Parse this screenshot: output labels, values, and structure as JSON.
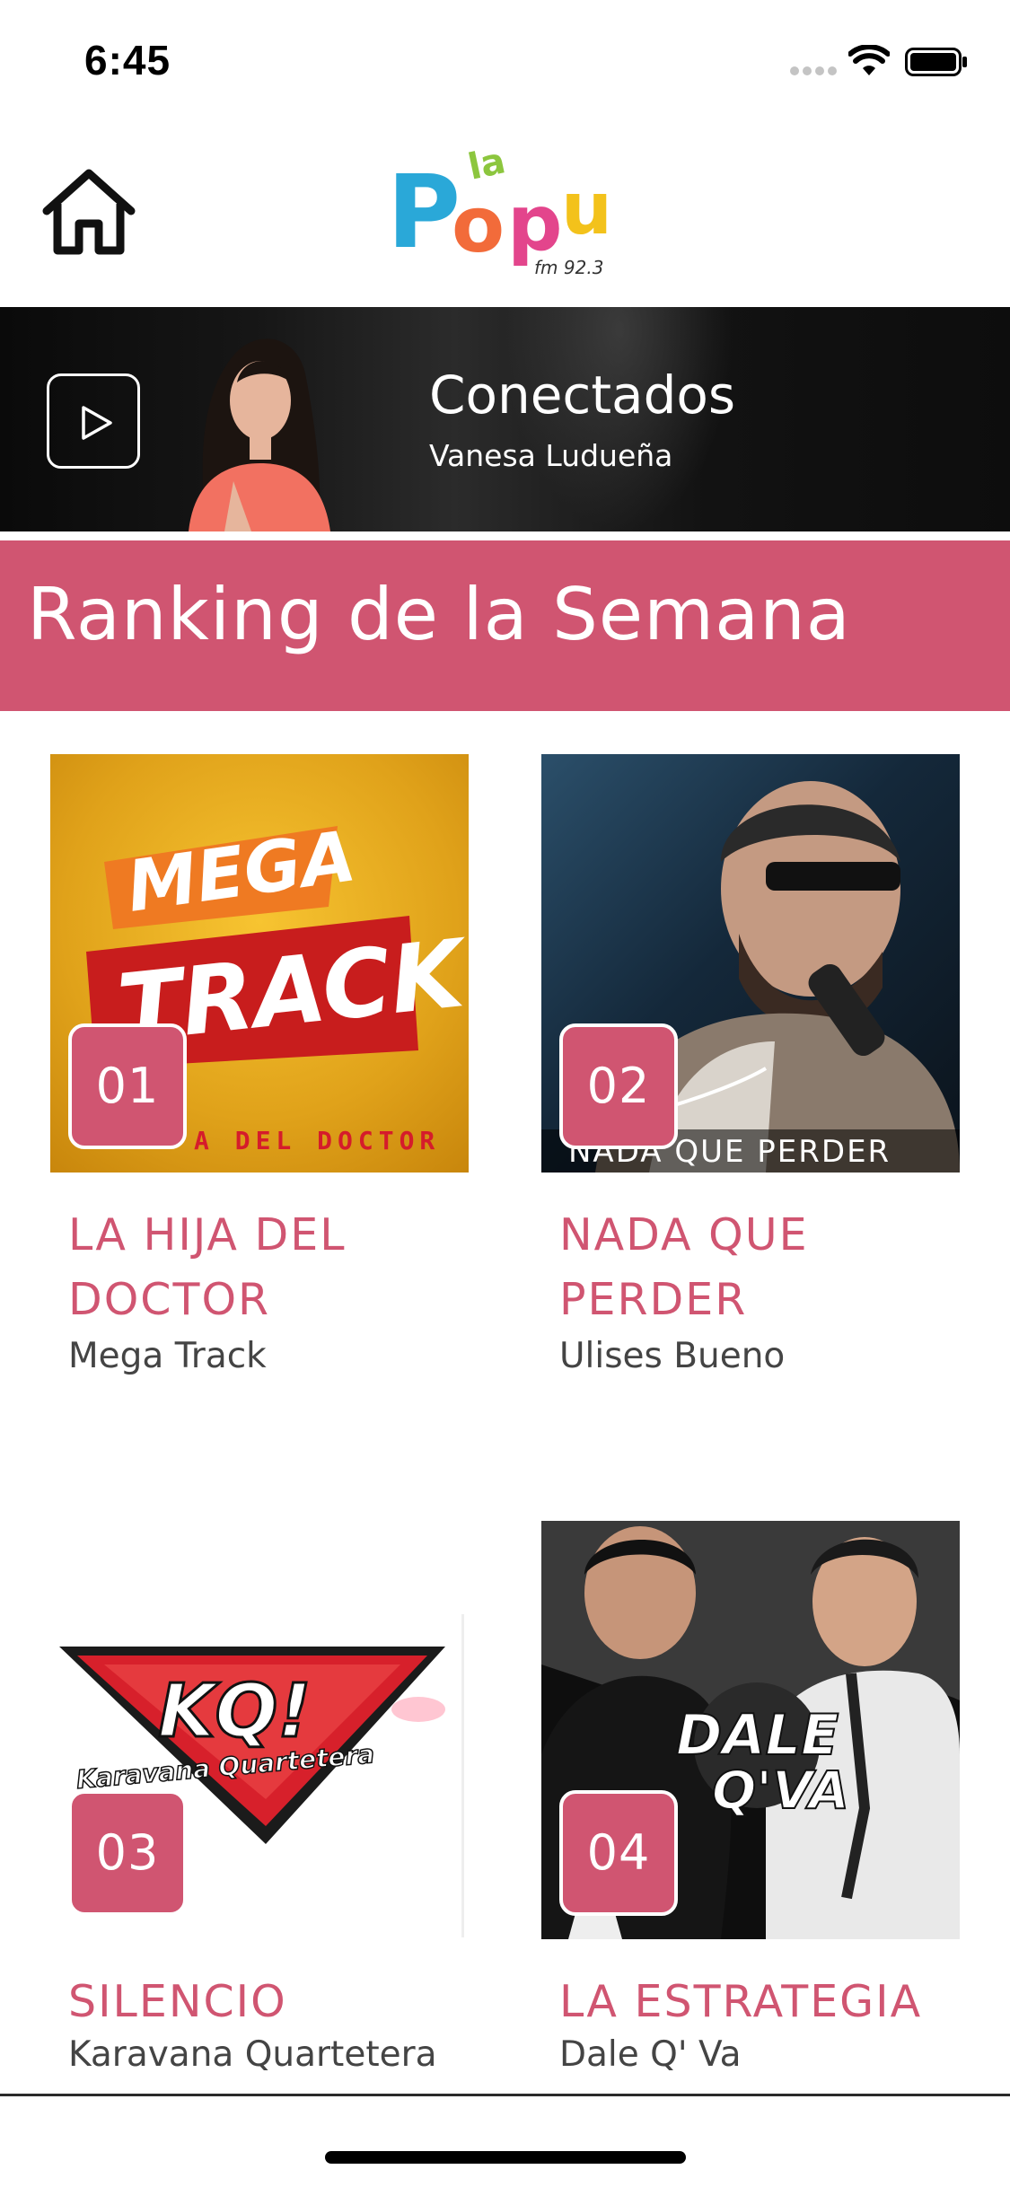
{
  "status": {
    "time": "6:45"
  },
  "header": {
    "logo_name": "la-popu-logo"
  },
  "now_playing": {
    "title": "Conectados",
    "host": "Vanesa Ludueña"
  },
  "ranking": {
    "title": "Ranking de la Semana",
    "items": [
      {
        "rank": "01",
        "title_line1": "LA HIJA DEL",
        "title_line2": "DOCTOR",
        "artist": "Mega Track",
        "art_line1": "MEGA",
        "art_line2": "TRACK",
        "art_caption": "A DEL DOCTOR"
      },
      {
        "rank": "02",
        "title_line1": "NADA QUE",
        "title_line2": "PERDER",
        "artist": "Ulises Bueno",
        "art_caption": "NADA QUE PERDER"
      },
      {
        "rank": "03",
        "title_line1": "SILENCIO",
        "title_line2": "",
        "artist": "Karavana Quartetera",
        "art_line1": "KQ!",
        "art_line2": "Karavana Quartetera"
      },
      {
        "rank": "04",
        "title_line1": "LA ESTRATEGIA",
        "title_line2": "",
        "artist": "Dale Q' Va",
        "art_line1": "DALE",
        "art_line2": "Q'VA"
      }
    ]
  },
  "colors": {
    "accent": "#d05571",
    "banner_bg": "#111111"
  },
  "icons": [
    "home-icon",
    "play-icon",
    "wifi-icon",
    "battery-icon",
    "signal-icon"
  ]
}
